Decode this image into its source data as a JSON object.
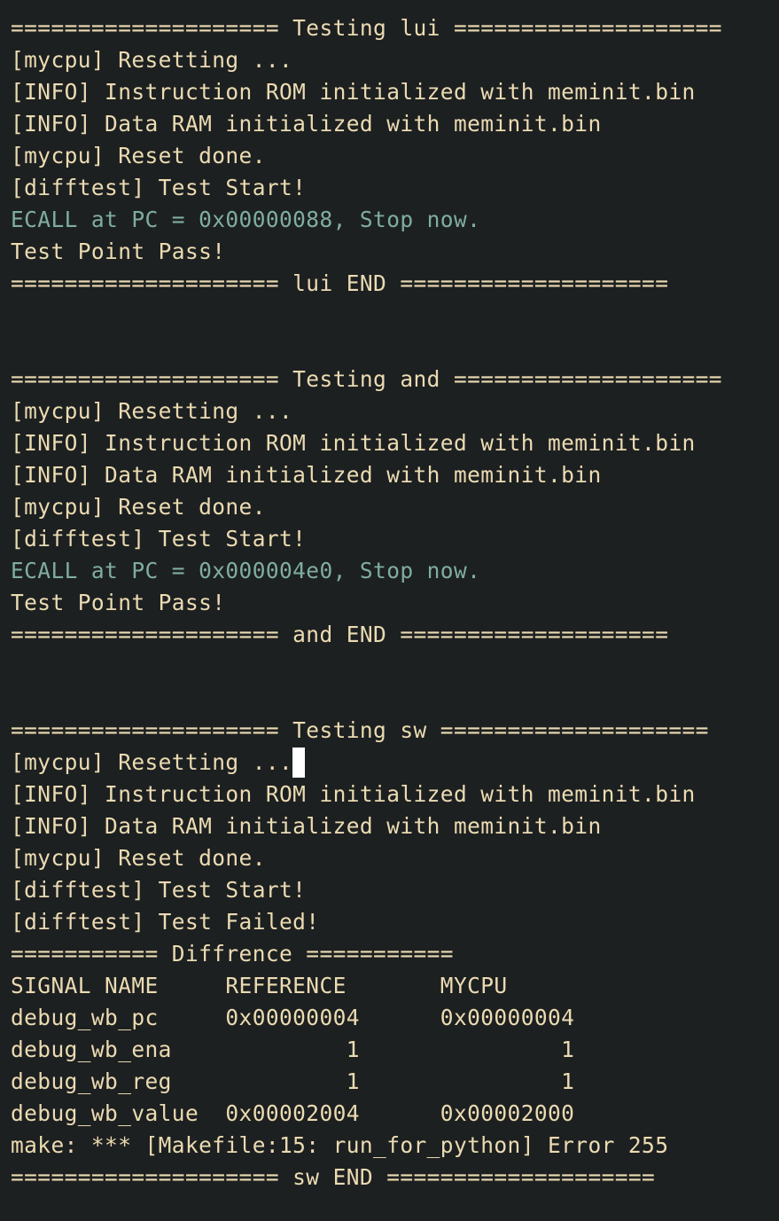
{
  "terminal": {
    "sections": [
      {
        "header": "==================== Testing lui ====================",
        "lines": [
          "[mycpu] Resetting ...",
          "[INFO] Instruction ROM initialized with meminit.bin",
          "[INFO] Data RAM initialized with meminit.bin",
          "[mycpu] Reset done.",
          "[difftest] Test Start!"
        ],
        "ecall": "ECALL at PC = 0x00000088, Stop now.",
        "result": "Test Point Pass!",
        "footer": "==================== lui END ===================="
      },
      {
        "header": "==================== Testing and ====================",
        "lines": [
          "[mycpu] Resetting ...",
          "[INFO] Instruction ROM initialized with meminit.bin",
          "[INFO] Data RAM initialized with meminit.bin",
          "[mycpu] Reset done.",
          "[difftest] Test Start!"
        ],
        "ecall": "ECALL at PC = 0x000004e0, Stop now.",
        "result": "Test Point Pass!",
        "footer": "==================== and END ===================="
      }
    ],
    "sw": {
      "header": "==================== Testing sw ====================",
      "resetting": "[mycpu] Resetting ...",
      "lines": [
        "[INFO] Instruction ROM initialized with meminit.bin",
        "[INFO] Data RAM initialized with meminit.bin",
        "[mycpu] Reset done.",
        "[difftest] Test Start!",
        "[difftest] Test Failed!"
      ],
      "diff_header": "=========== Diffrence ===========",
      "table": {
        "columns": [
          "SIGNAL NAME",
          "REFERENCE",
          "MYCPU"
        ],
        "rows": [
          [
            "debug_wb_pc",
            "0x00000004",
            "0x00000004"
          ],
          [
            "debug_wb_ena",
            "1",
            "1"
          ],
          [
            "debug_wb_reg",
            "1",
            "1"
          ],
          [
            "debug_wb_value",
            "0x00002004",
            "0x00002000"
          ]
        ]
      },
      "make_error": "make: *** [Makefile:15: run_for_python] Error 255",
      "footer": "==================== sw END ===================="
    },
    "colors": {
      "background": "#1d2021",
      "text": "#ebdbb2",
      "ecall": "#7fae9e",
      "cursor": "#ffffff"
    }
  }
}
